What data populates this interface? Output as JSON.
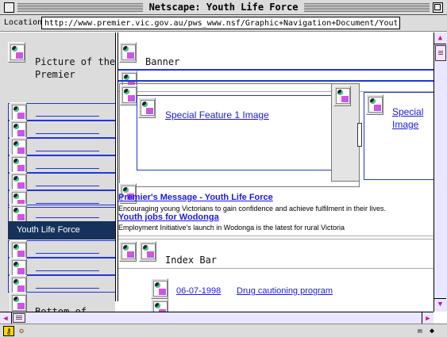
{
  "window": {
    "title": "Netscape: Youth Life Force"
  },
  "location": {
    "label": "Location:",
    "url": "http://www.premier.vic.gov.au/pws_www.nsf/Graphic+Navigation+Document/Youth+Life+Force?"
  },
  "left_frame": {
    "premier_label_line1": "Picture of the",
    "premier_label_line2": "Premier",
    "selected_item": "Youth Life Force",
    "bottom_label": "Bottom of"
  },
  "main": {
    "banner_label": "Banner",
    "special_feature_1": "Special Feature 1 Image",
    "special_feature_2_line1": "Special",
    "special_feature_2_line2": "Image",
    "headline_1": "Premier's Message - Youth Life Force",
    "headline_1_desc": "Encouraging young Victorians to gain confidence and achieve fulfilment in their lives.",
    "headline_2": "Youth jobs for Wodonga",
    "headline_2_desc": "Employment Initiative's launch in Wodonga is the latest for rural Victoria",
    "index_bar_label": "Index Bar",
    "news_date": "06-07-1998",
    "news_title": "Drug cautioning program"
  },
  "icons": {
    "image_placeholder": "broken-image-icon",
    "scroll_up": "arrow-up-icon",
    "scroll_down": "arrow-down-icon",
    "scroll_left": "arrow-left-icon",
    "scroll_right": "arrow-right-icon",
    "mail": "mail-icon",
    "security": "security-key-icon"
  },
  "colors": {
    "link": "#1a1adc",
    "frame_border": "#2235d9",
    "selected_nav": "#16325c",
    "frame_background": "#dcdcdc"
  }
}
